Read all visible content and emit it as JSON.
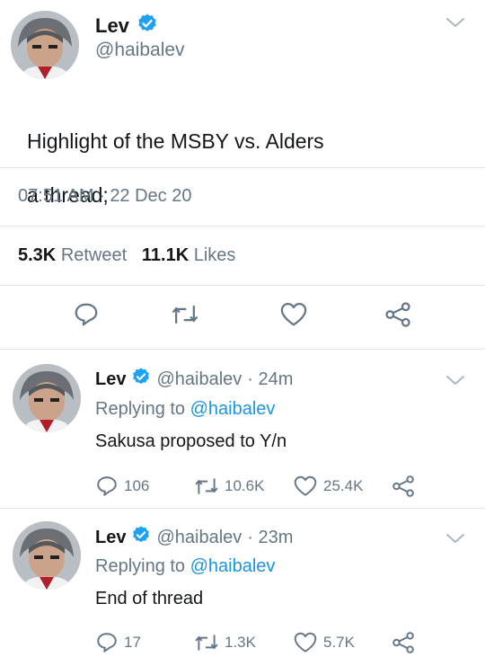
{
  "main_tweet": {
    "name": "Lev",
    "handle": "@haibalev",
    "text_line1": "Highlight of the MSBY vs. Alders",
    "text_line2": "a thread;",
    "time": "07:51 AM",
    "dot": "·",
    "date": "22 Dec 20",
    "retweets_count": "5.3K",
    "retweets_label": "Retweet",
    "likes_count": "11.1K",
    "likes_label": "Likes"
  },
  "replies": [
    {
      "name": "Lev",
      "handle": "@haibalev",
      "time": "· 24m",
      "replying_prefix": "Replying to",
      "replying_to": "@haibalev",
      "text": "Sakusa proposed to Y/n",
      "replies_count": "106",
      "retweets_count": "10.6K",
      "likes_count": "25.4K"
    },
    {
      "name": "Lev",
      "handle": "@haibalev",
      "time": "· 23m",
      "replying_prefix": "Replying to",
      "replying_to": "@haibalev",
      "text": "End of thread",
      "replies_count": "17",
      "retweets_count": "1.3K",
      "likes_count": "5.7K"
    }
  ],
  "icons": {
    "verified": "verified-badge-icon",
    "chevron": "chevron-down-icon",
    "reply": "reply-bubble-icon",
    "retweet": "retweet-icon",
    "like": "heart-icon",
    "share": "share-icon"
  },
  "colors": {
    "accent": "#1da1f2",
    "link": "#1b95e0",
    "muted": "#657786",
    "divider": "#e1e8ed"
  }
}
